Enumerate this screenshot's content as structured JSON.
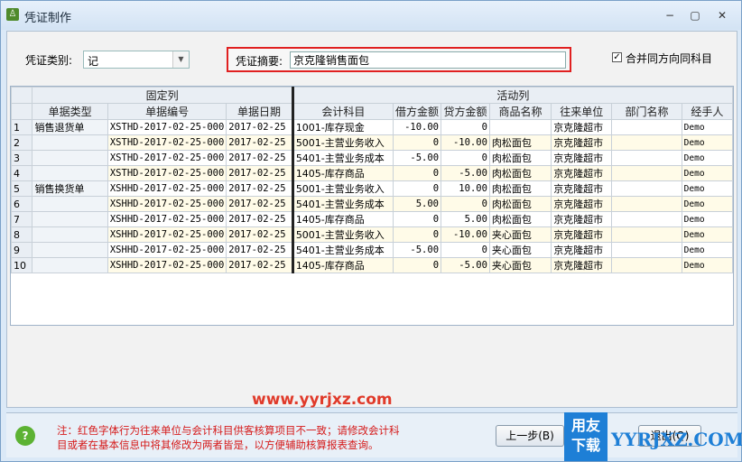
{
  "window": {
    "title": "凭证制作",
    "min": "−",
    "max": "▢",
    "close": "✕"
  },
  "form": {
    "type_label": "凭证类别:",
    "type_value": "记",
    "summary_label": "凭证摘要:",
    "summary_value": "京克隆销售面包",
    "merge_label": "合并同方向同科目",
    "merge_checked": "✓"
  },
  "grid": {
    "group_fixed": "固定列",
    "group_active": "活动列",
    "headers": [
      "单据类型",
      "单据编号",
      "单据日期",
      "会计科目",
      "借方金额",
      "贷方金额",
      "商品名称",
      "往来单位",
      "部门名称",
      "经手人"
    ],
    "rows": [
      {
        "n": "1",
        "type": "销售退货单",
        "code": "XSTHD-2017-02-25-000",
        "date": "2017-02-25",
        "acct": "1001-库存现金",
        "debit": "-10.00",
        "credit": "0",
        "goods": "",
        "unit": "京克隆超市",
        "dept": "",
        "handler": "Demo"
      },
      {
        "n": "2",
        "type": "",
        "code": "XSTHD-2017-02-25-000",
        "date": "2017-02-25",
        "acct": "5001-主营业务收入",
        "debit": "0",
        "credit": "-10.00",
        "goods": "肉松面包",
        "unit": "京克隆超市",
        "dept": "",
        "handler": "Demo"
      },
      {
        "n": "3",
        "type": "",
        "code": "XSTHD-2017-02-25-000",
        "date": "2017-02-25",
        "acct": "5401-主营业务成本",
        "debit": "-5.00",
        "credit": "0",
        "goods": "肉松面包",
        "unit": "京克隆超市",
        "dept": "",
        "handler": "Demo"
      },
      {
        "n": "4",
        "type": "",
        "code": "XSTHD-2017-02-25-000",
        "date": "2017-02-25",
        "acct": "1405-库存商品",
        "debit": "0",
        "credit": "-5.00",
        "goods": "肉松面包",
        "unit": "京克隆超市",
        "dept": "",
        "handler": "Demo"
      },
      {
        "n": "5",
        "type": "销售换货单",
        "code": "XSHHD-2017-02-25-000",
        "date": "2017-02-25",
        "acct": "5001-主营业务收入",
        "debit": "0",
        "credit": "10.00",
        "goods": "肉松面包",
        "unit": "京克隆超市",
        "dept": "",
        "handler": "Demo"
      },
      {
        "n": "6",
        "type": "",
        "code": "XSHHD-2017-02-25-000",
        "date": "2017-02-25",
        "acct": "5401-主营业务成本",
        "debit": "5.00",
        "credit": "0",
        "goods": "肉松面包",
        "unit": "京克隆超市",
        "dept": "",
        "handler": "Demo"
      },
      {
        "n": "7",
        "type": "",
        "code": "XSHHD-2017-02-25-000",
        "date": "2017-02-25",
        "acct": "1405-库存商品",
        "debit": "0",
        "credit": "5.00",
        "goods": "肉松面包",
        "unit": "京克隆超市",
        "dept": "",
        "handler": "Demo"
      },
      {
        "n": "8",
        "type": "",
        "code": "XSHHD-2017-02-25-000",
        "date": "2017-02-25",
        "acct": "5001-主营业务收入",
        "debit": "0",
        "credit": "-10.00",
        "goods": "夹心面包",
        "unit": "京克隆超市",
        "dept": "",
        "handler": "Demo"
      },
      {
        "n": "9",
        "type": "",
        "code": "XSHHD-2017-02-25-000",
        "date": "2017-02-25",
        "acct": "5401-主营业务成本",
        "debit": "-5.00",
        "credit": "0",
        "goods": "夹心面包",
        "unit": "京克隆超市",
        "dept": "",
        "handler": "Demo"
      },
      {
        "n": "10",
        "type": "",
        "code": "XSHHD-2017-02-25-000",
        "date": "2017-02-25",
        "acct": "1405-库存商品",
        "debit": "0",
        "credit": "-5.00",
        "goods": "夹心面包",
        "unit": "京克隆超市",
        "dept": "",
        "handler": "Demo"
      }
    ]
  },
  "footer": {
    "note_line1": "注：红色字体行为往来单位与会计科目供客核算项目不一致；请修改会计科",
    "note_line2": "目或者在基本信息中将其修改为两者皆是，以方便辅助核算报表查询。",
    "prev_button": "上一步(B)",
    "exit_button": "退出(Q)"
  },
  "watermark": {
    "url": "www.yyrjxz.com",
    "logo_top": "用友",
    "logo_bottom": "下载",
    "site": "YYRJXZ.COM"
  }
}
